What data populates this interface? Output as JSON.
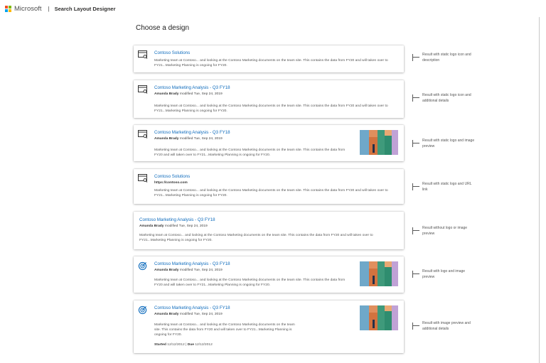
{
  "header": {
    "brand": "Microsoft",
    "separator": "|",
    "app_title": "Search Layout Designer",
    "logo_colors": [
      "#f25022",
      "#7fba00",
      "#00a4ef",
      "#ffb900"
    ]
  },
  "page": {
    "title": "Choose a design"
  },
  "colors": {
    "link": "#0f6cbd"
  },
  "cards": [
    {
      "title": "Contoso Solutions",
      "desc": "Marketing team at Contoso... and looking at the Contoso Marketing documents on the team site. This contains the data from FY20 and will taken over to FY21...Marketing Planning is ongoing for FY20.",
      "note": "Result with static logo icon and description",
      "icon": "site-page-icon"
    },
    {
      "title": "Contoso Marketing Analysis - Q3 FY18",
      "author": "Amanda Brady",
      "modified": "modified Tue, Sep 24, 2019",
      "desc": "Marketing team at Contoso... and looking at the Contoso Marketing documents on the team site. This contains the data from FY20 and will taken over to FY21...Marketing Planning is ongoing for FY20.",
      "note": "Result with static logo icon and additional details",
      "icon": "site-page-icon"
    },
    {
      "title": "Contoso Marketing Analysis - Q3 FY18",
      "author": "Amanda Brady",
      "modified": "modified Tue, Sep 24, 2019",
      "desc": "Marketing team at Contoso... and looking at the Contoso Marketing documents on the team site. This contains the data from FY20 and will taken over to FY21...Marketing Planning is ongoing for FY20.",
      "note": "Result with static logo and image preview",
      "icon": "site-page-icon"
    },
    {
      "title": "Contoso Solutions",
      "url": "https://contoso.com",
      "desc": "Marketing team at Contoso... and looking at the Contoso Marketing documents on the team site. This contains the data from FY20 and will taken over to FY21...Marketing Planning is ongoing for FY20.",
      "note": "Result with static logo and URL link",
      "icon": "site-page-icon"
    },
    {
      "title": "Contoso Marketing Analysis - Q3 FY18",
      "author": "Amanda Brady",
      "modified": "modified Tue, Sep 24, 2019",
      "desc": "Marketing team at Contoso... and looking at the Contoso Marketing documents on the team site. This contains the data from FY20 and will taken over to FY21...Marketing Planning is ongoing for FY20.",
      "note": "Result without logo or image preview"
    },
    {
      "title": "Contoso Marketing Analysis - Q3 FY18",
      "author": "Amanda Brady",
      "modified": "modified Tue, Sep 24, 2019",
      "desc": "Marketing team at Contoso... and looking at the Contoso Marketing documents on the team site. This contains the data from FY20 and will taken over to FY21...Marketing Planning is ongoing for FY20.",
      "note": "Result with logo and image preview",
      "icon": "target-icon"
    },
    {
      "title": "Contoso Marketing Analysis - Q3 FY18",
      "author": "Amanda Brady",
      "modified": "modified Tue, Sep 24, 2019",
      "desc": "Marketing team at Contoso... and looking at the Contoso Marketing documents on the team site. This contains the data from FY20 and will taken over to FY21...Marketing Planning is ongoing for FY20.",
      "started_label": "Started",
      "started": "12/12/2012",
      "due_label": "Due",
      "due": "12/12/2012",
      "note": "Result with image preview and additional details",
      "icon": "target-icon"
    }
  ]
}
